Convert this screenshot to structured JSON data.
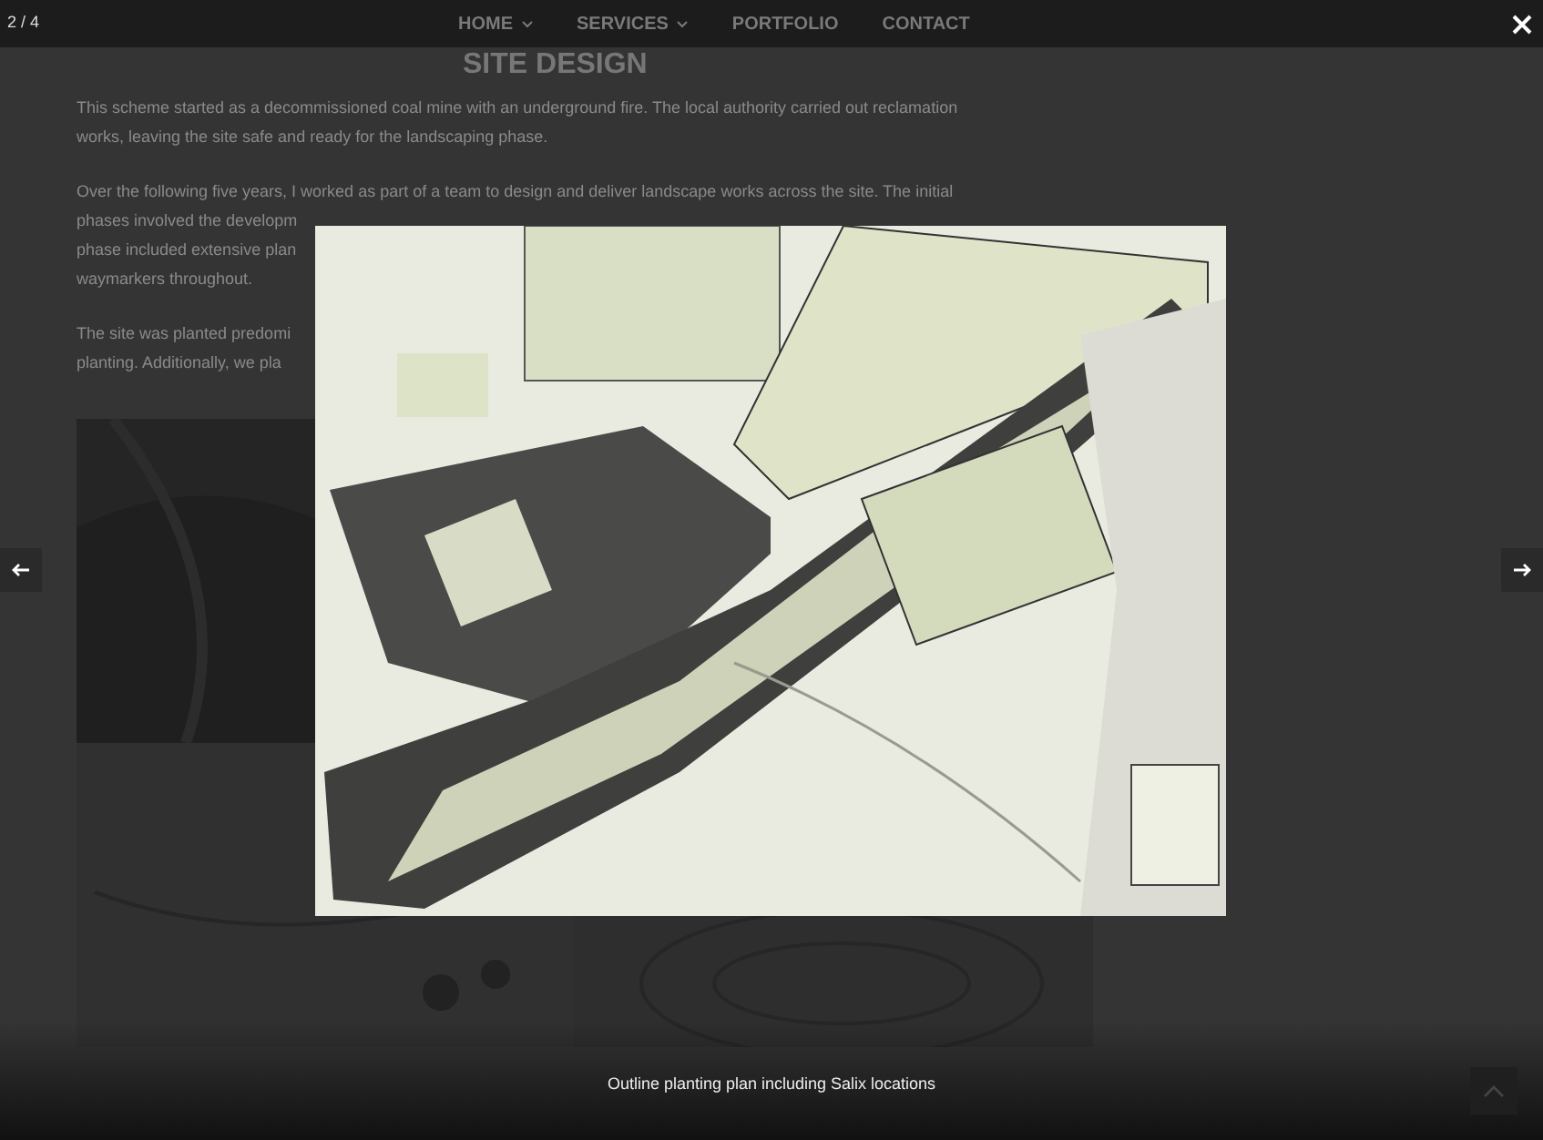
{
  "lightbox": {
    "counter": "2 / 4",
    "caption": "Outline planting plan including Salix locations"
  },
  "nav": {
    "items": [
      {
        "label": "HOME",
        "dropdown": true
      },
      {
        "label": "SERVICES",
        "dropdown": true
      },
      {
        "label": "PORTFOLIO",
        "dropdown": false
      },
      {
        "label": "CONTACT",
        "dropdown": false
      }
    ]
  },
  "page": {
    "title": "SITE DESIGN",
    "paragraphs": [
      {
        "lines": [
          "This scheme started as a decommissioned coal mine with an underground fire. The local authority carried out reclamation",
          "works, leaving the site safe and ready for the landscaping phase."
        ]
      },
      {
        "lines": [
          "Over the following five years, I worked as part of a team to design and deliver landscape works across the site. The initial",
          "phases involved the developm",
          "phase included extensive plan",
          "waymarkers throughout."
        ]
      },
      {
        "lines": [
          "The site was planted predomi",
          "planting. Additionally, we pla"
        ]
      }
    ]
  }
}
